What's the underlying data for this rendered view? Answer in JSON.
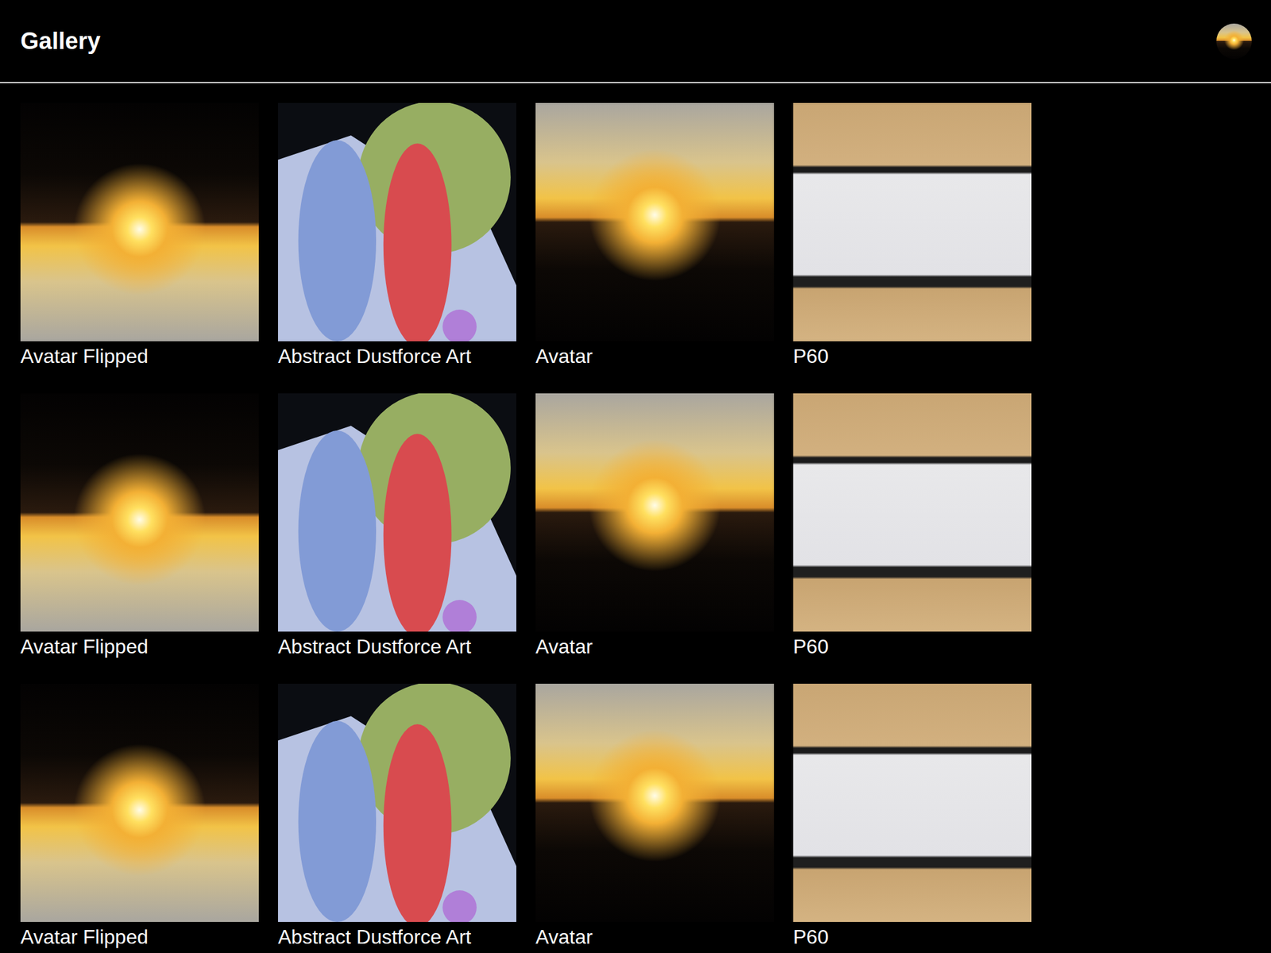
{
  "header": {
    "title": "Gallery",
    "avatar": {
      "kind": "avatar"
    }
  },
  "items": [
    {
      "caption": "Avatar Flipped",
      "kind": "avatar-flipped"
    },
    {
      "caption": "Abstract Dustforce Art",
      "kind": "abstract"
    },
    {
      "caption": "Avatar",
      "kind": "avatar"
    },
    {
      "caption": "P60",
      "kind": "keyboard"
    },
    {
      "caption": "Avatar Flipped",
      "kind": "avatar-flipped"
    },
    {
      "caption": "Abstract Dustforce Art",
      "kind": "abstract"
    },
    {
      "caption": "Avatar",
      "kind": "avatar"
    },
    {
      "caption": "P60",
      "kind": "keyboard"
    },
    {
      "caption": "Avatar Flipped",
      "kind": "avatar-flipped"
    },
    {
      "caption": "Abstract Dustforce Art",
      "kind": "abstract"
    },
    {
      "caption": "Avatar",
      "kind": "avatar"
    },
    {
      "caption": "P60",
      "kind": "keyboard"
    }
  ]
}
